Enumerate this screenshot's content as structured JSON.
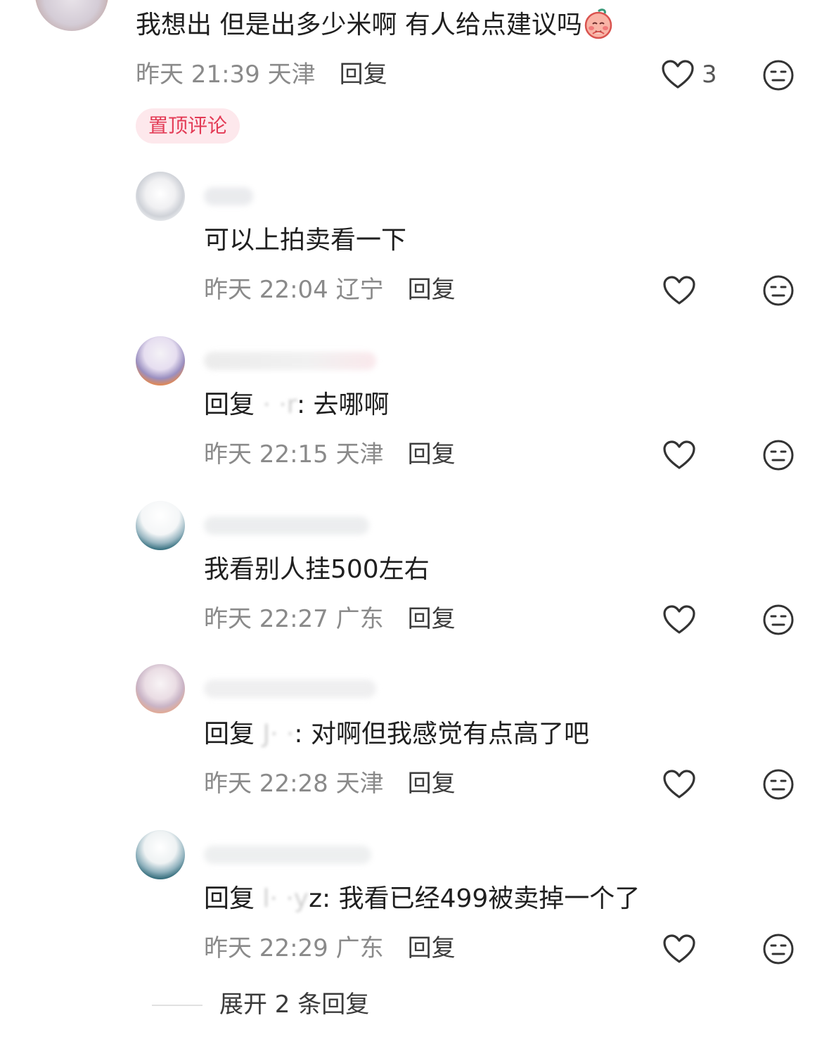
{
  "main_comment": {
    "text": "我想出 但是出多少米啊 有人给点建议吗",
    "time": "昨天 21:39 天津",
    "reply_label": "回复",
    "like_count": "3",
    "pinned_badge": "置顶评论"
  },
  "replies": [
    {
      "text": "可以上拍卖看一下",
      "time": "昨天 22:04 辽宁",
      "reply_label": "回复"
    },
    {
      "prefix": "回复",
      "masked_target": "  ·  ·r",
      "rest": ": 去哪啊",
      "time": "昨天 22:15 天津",
      "reply_label": "回复"
    },
    {
      "text": "我看别人挂500左右",
      "time": "昨天 22:27 广东",
      "reply_label": "回复"
    },
    {
      "prefix": "回复",
      "masked_target": "J·     ·",
      "rest": ": 对啊但我感觉有点高了吧",
      "time": "昨天 22:28 天津",
      "reply_label": "回复"
    },
    {
      "prefix": "回复",
      "masked_target": "l·  ·y",
      "rest": "z: 我看已经499被卖掉一个了",
      "time": "昨天 22:29 广东",
      "reply_label": "回复"
    }
  ],
  "expand_label": "展开 2 条回复",
  "colors": {
    "pin_bg": "#fde8ec",
    "pin_text": "#e33a55",
    "meta_text": "#8a8a8a",
    "body_text": "#1f1f1f"
  }
}
